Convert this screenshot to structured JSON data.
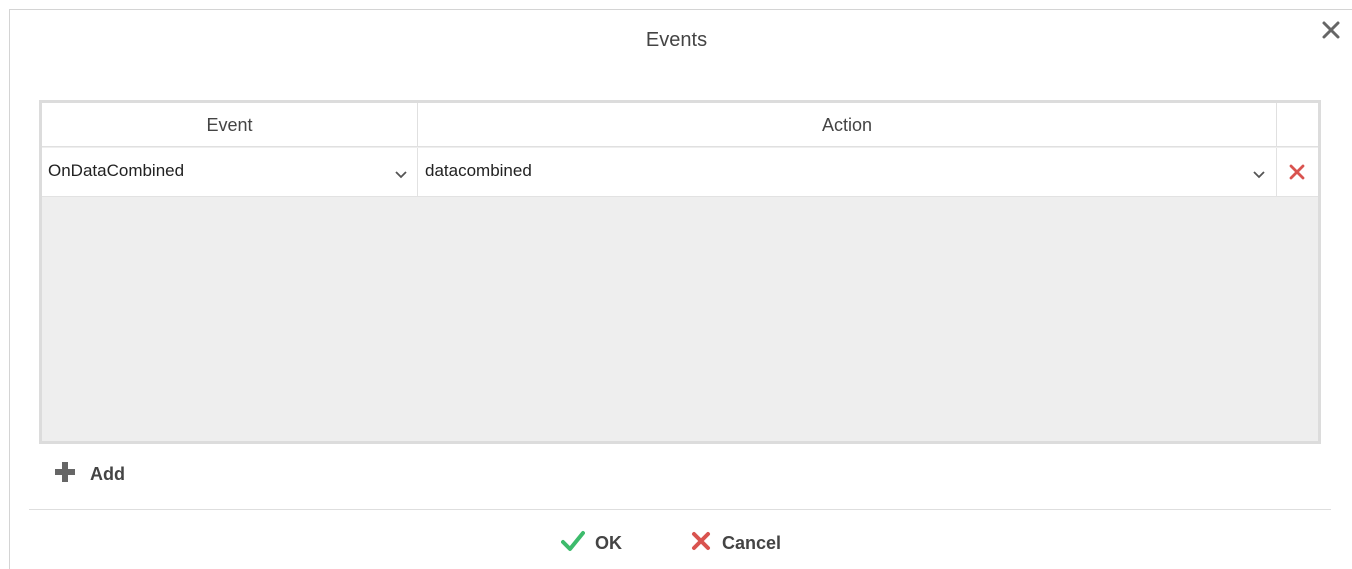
{
  "dialog": {
    "title": "Events"
  },
  "grid": {
    "columns": [
      "Event",
      "Action",
      ""
    ],
    "rows": [
      {
        "event": "OnDataCombined",
        "action": "datacombined"
      }
    ]
  },
  "toolbar": {
    "add_label": "Add"
  },
  "footer": {
    "ok_label": "OK",
    "cancel_label": "Cancel"
  },
  "colors": {
    "ok_check": "#3dbb6c",
    "delete_x": "#d9534f",
    "icon_gray": "#666666"
  }
}
